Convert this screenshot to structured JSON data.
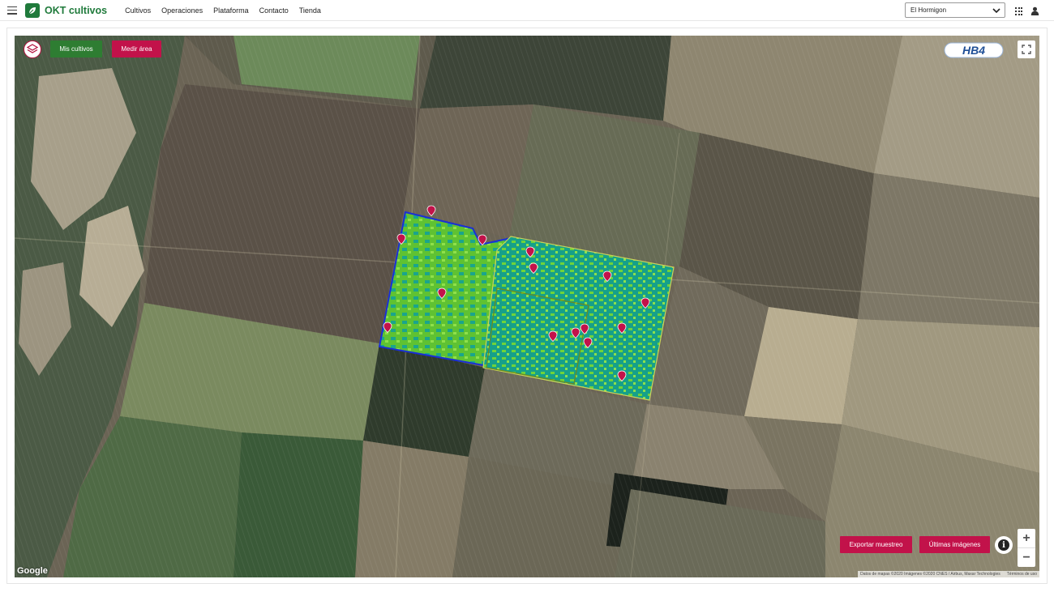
{
  "navbar": {
    "brand": "OKT cultivos",
    "links": [
      "Cultivos",
      "Operaciones",
      "Plataforma",
      "Contacto",
      "Tienda"
    ],
    "farm_selected": "El Hormigon"
  },
  "map": {
    "buttons": {
      "my_crops": "Mis cultivos",
      "measure_area": "Medir área",
      "export_sampling": "Exportar muestreo",
      "latest_images": "Últimas imágenes"
    },
    "hb4_logo": "HB4",
    "info_label": "i",
    "zoom_in": "+",
    "zoom_out": "−",
    "google_logo": "Google",
    "attribution": "Datos de mapas ©2020 Imágenes ©2020 CNES / Airbus, Maxar Technologies",
    "terms": "Términos de uso",
    "colors": {
      "accent_green": "#2e7d32",
      "accent_red": "#c2124a",
      "ndvi_light": "#7ed321",
      "ndvi_teal": "#1aa58c",
      "field_border": "#1a2fd6"
    },
    "sample_points_count": 17
  }
}
